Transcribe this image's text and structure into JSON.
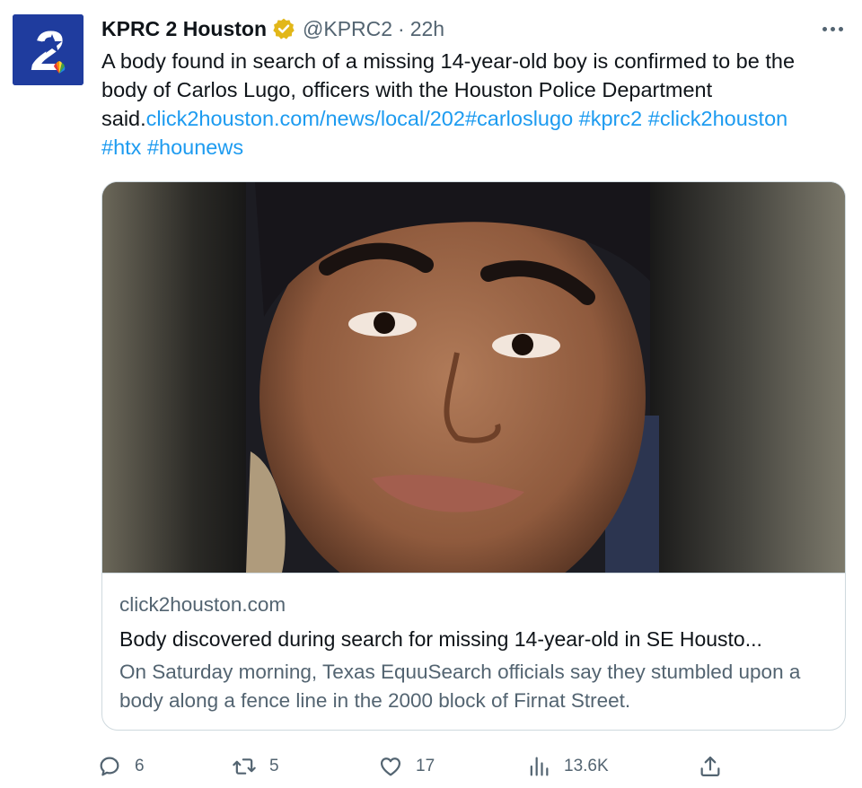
{
  "account": {
    "avatar_text": "2",
    "display_name": "KPRC 2 Houston",
    "handle": "@KPRC2",
    "separator": "·",
    "time": "22h"
  },
  "tweet": {
    "text": "A body found in search of a missing 14-year-old boy is confirmed to be the body of Carlos Lugo, officers with the Houston Police Department said.",
    "link": "click2houston.com/news/local/202",
    "hashtags": [
      "#carloslugo",
      "#kprc2",
      "#click2houston",
      "#htx",
      "#hounews"
    ]
  },
  "card": {
    "domain": "click2houston.com",
    "title": "Body discovered during search for missing 14-year-old in SE Housto...",
    "description": "On Saturday morning, Texas EquuSearch officials say they stumbled upon a body along a fence line in the 2000 block of Firnat Street."
  },
  "actions": {
    "replies": "6",
    "retweets": "5",
    "likes": "17",
    "views": "13.6K"
  },
  "icons": {
    "verified": "verified-badge-icon",
    "more": "more-options-icon",
    "reply": "reply-icon",
    "retweet": "retweet-icon",
    "like": "heart-icon",
    "views": "views-chart-icon",
    "share": "share-icon"
  },
  "colors": {
    "link": "#1d9bf0",
    "secondary_text": "#536471",
    "verified_gold": "#e2b719",
    "avatar_blue": "#1f3c9e"
  }
}
